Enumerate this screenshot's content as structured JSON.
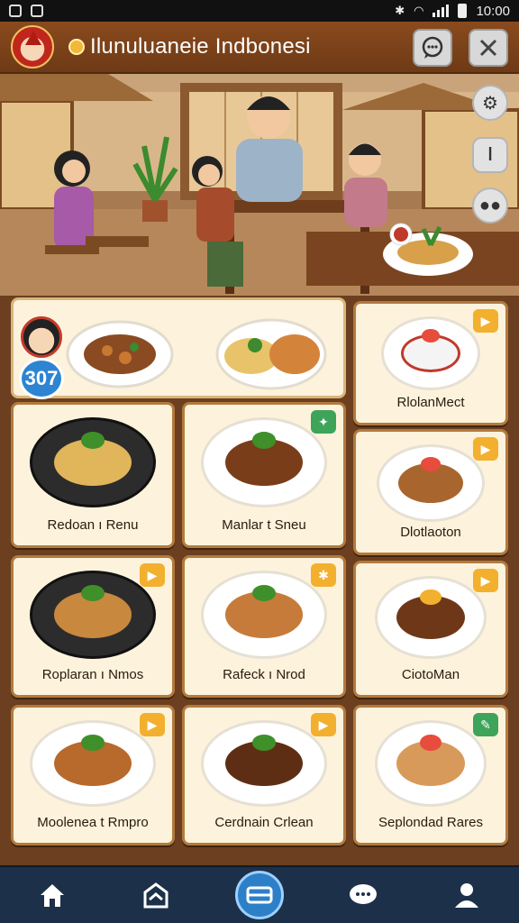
{
  "status_bar": {
    "time": "10:00"
  },
  "header": {
    "title": "Ilunuluaneie Indbonesi"
  },
  "featured": {
    "level": "307"
  },
  "menu": {
    "items": [
      {
        "name": "RlolanMect",
        "badge": "orange"
      },
      {
        "name": "Redoan ı Renu",
        "badge": ""
      },
      {
        "name": "Manlar t Sneu",
        "badge": "green"
      },
      {
        "name": "Dlotlaoton",
        "badge": "orange"
      },
      {
        "name": "Roplaran ı Nmos",
        "badge": "orange"
      },
      {
        "name": "Rafeck ı Nrod",
        "badge": "orange"
      },
      {
        "name": "CiotoMan",
        "badge": "orange"
      },
      {
        "name": "Moolenea t Rmpro",
        "badge": "orange"
      },
      {
        "name": "Cerdnain Crlean",
        "badge": "orange"
      },
      {
        "name": "Seplondad Rares",
        "badge": "green"
      }
    ]
  },
  "colors": {
    "header": "#7a4119",
    "card_bg": "#fdf3dc",
    "card_border": "#b27a3e",
    "nav_bg": "#1c3049",
    "accent": "#2d7fc8"
  }
}
